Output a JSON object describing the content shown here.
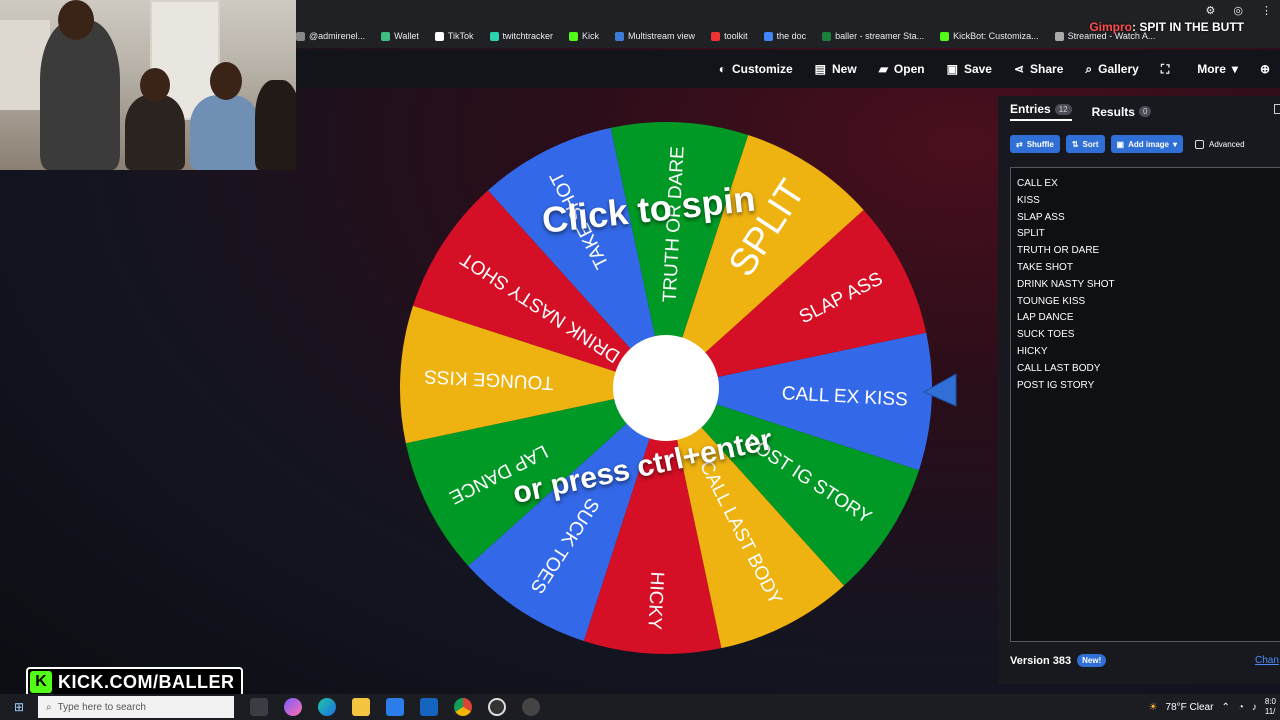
{
  "browser": {
    "bookmarks": [
      {
        "label": "@admirenel...",
        "color": "#888888"
      },
      {
        "label": "Wallet",
        "color": "#3fbf7f"
      },
      {
        "label": "TikTok",
        "color": "#ffffff"
      },
      {
        "label": "twitchtracker",
        "color": "#2bd3b0"
      },
      {
        "label": "Kick",
        "color": "#53fc18"
      },
      {
        "label": "Multistream view",
        "color": "#3d7bd9"
      },
      {
        "label": "toolkit",
        "color": "#e33"
      },
      {
        "label": "the doc",
        "color": "#4285f4"
      },
      {
        "label": "baller - streamer Sta...",
        "color": "#1a7f3c"
      },
      {
        "label": "KickBot: Customiza...",
        "color": "#53fc18"
      },
      {
        "label": "Streamed - Watch A...",
        "color": "#aaaaaa"
      }
    ],
    "overlay_prefix": "Gimpro",
    "overlay_text": ": SPIT IN THE BUTT"
  },
  "toolbar": {
    "items": [
      {
        "label": "Customize",
        "icon": "palette-icon"
      },
      {
        "label": "New",
        "icon": "file-icon"
      },
      {
        "label": "Open",
        "icon": "folder-icon"
      },
      {
        "label": "Save",
        "icon": "save-icon"
      },
      {
        "label": "Share",
        "icon": "share-icon"
      },
      {
        "label": "Gallery",
        "icon": "search-icon"
      },
      {
        "label": "",
        "icon": "fullscreen-icon"
      },
      {
        "label": "More",
        "icon": "chevron-down-icon"
      }
    ]
  },
  "wheel": {
    "center_text_top": "Click to spin",
    "center_text_bottom": "or press ctrl+enter",
    "colors": [
      "#3369e8",
      "#d50f25",
      "#eeb211",
      "#009925"
    ],
    "segments": [
      "CALL EX KISS",
      "POST IG STORY",
      "CALL LAST BODY",
      "HICKY",
      "SUCK TOES",
      "LAP DANCE",
      "TOUNGE KISS",
      "DRINK NASTY SHOT",
      "TAKE SHOT",
      "TRUTH OR DARE",
      "SPLIT",
      "SLAP ASS"
    ]
  },
  "panel": {
    "tabs": [
      {
        "label": "Entries",
        "count": "12"
      },
      {
        "label": "Results",
        "count": "0"
      }
    ],
    "buttons": {
      "shuffle": "Shuffle",
      "sort": "Sort",
      "add_image": "Add image",
      "advanced": "Advanced"
    },
    "entries": [
      "CALL EX",
      "KISS",
      "SLAP ASS",
      "SPLIT",
      "TRUTH OR DARE",
      "TAKE SHOT",
      "DRINK NASTY SHOT",
      "TOUNGE KISS",
      "LAP DANCE",
      "SUCK TOES",
      "HICKY",
      "CALL LAST BODY",
      "POST IG STORY"
    ],
    "version": "Version 383",
    "new_badge": "New!",
    "changelog": "Chan"
  },
  "kick_banner": "KICK.COM/BALLER",
  "taskbar": {
    "search_placeholder": "Type here to search",
    "weather": "78°F  Clear",
    "time": "8:0",
    "date": "11/"
  }
}
